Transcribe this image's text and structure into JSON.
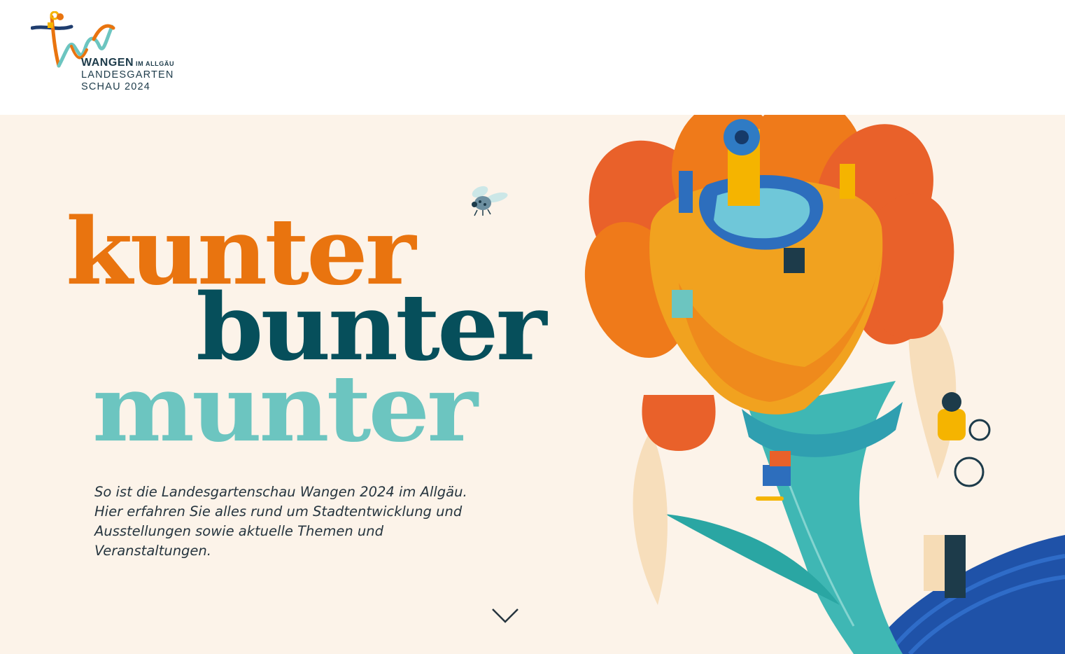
{
  "header": {
    "logo": {
      "line1_main": "WANGEN",
      "line1_small": "IM ALLGÄU",
      "line2": "LANDESGARTEN",
      "line3": "SCHAU 2024",
      "colors": [
        "#e9740f",
        "#1f3d6e",
        "#6cc5c0",
        "#f5b400"
      ]
    }
  },
  "hero": {
    "headline": [
      "kunter",
      "bunter",
      "munter"
    ],
    "headline_colors": [
      "#e9740f",
      "#064f5b",
      "#6cc5c0"
    ],
    "intro": "So ist die Landesgartenschau Wangen 2024 im Allgäu. Hier erfahren Sie alles rund um Stadtentwicklung und Ausstellungen sowie aktuelle Themen und Veranstaltungen.",
    "scroll_icon": "chevron-down-icon",
    "illustration_icon": "flower-illustration"
  }
}
